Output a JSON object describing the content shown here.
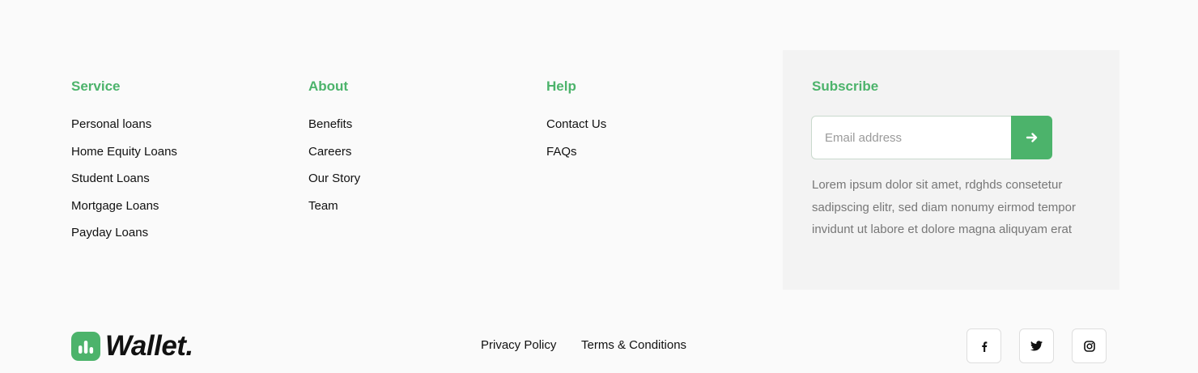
{
  "columns": [
    {
      "title": "Service",
      "items": [
        "Personal loans",
        "Home Equity Loans",
        "Student Loans",
        "Mortgage Loans",
        "Payday Loans"
      ]
    },
    {
      "title": "About",
      "items": [
        "Benefits",
        "Careers",
        "Our Story",
        "Team"
      ]
    },
    {
      "title": "Help",
      "items": [
        "Contact Us",
        "FAQs"
      ]
    }
  ],
  "subscribe": {
    "title": "Subscribe",
    "email_placeholder": "Email address",
    "submit_icon": "arrow-right-icon",
    "description": "Lorem ipsum dolor sit amet, rdghds consetetur sadipscing elitr, sed diam nonumy eirmod tempor invidunt ut labore et dolore magna aliquyam erat"
  },
  "brand": {
    "name": "Wallet.",
    "logo_icon": "bar-chart-icon",
    "accent_color": "#4cb36b"
  },
  "legal": {
    "privacy": "Privacy Policy",
    "terms": "Terms & Conditions"
  },
  "social": [
    "facebook-icon",
    "twitter-icon",
    "instagram-icon"
  ]
}
